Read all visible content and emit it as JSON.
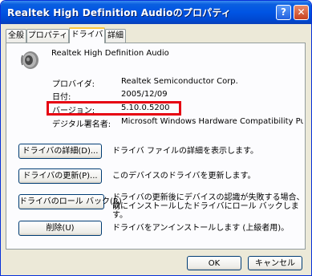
{
  "window": {
    "title": "Realtek High Definition Audioのプロパティ",
    "help_label": "?",
    "close_label": "✕"
  },
  "tabs": [
    {
      "label": "全般"
    },
    {
      "label": "プロパティ"
    },
    {
      "label": "ドライバ",
      "active": true
    },
    {
      "label": "詳細"
    }
  ],
  "device": {
    "name": "Realtek High Definition Audio",
    "icon": "speaker-icon"
  },
  "info": {
    "provider_label": "プロバイダ:",
    "provider_value": "Realtek Semiconductor Corp.",
    "date_label": "日付:",
    "date_value": "2005/12/09",
    "version_label": "バージョン:",
    "version_value": "5.10.0.5200",
    "signer_label": "デジタル署名者:",
    "signer_value": "Microsoft Windows Hardware Compatibility Publishe"
  },
  "actions": {
    "details_label": "ドライバの詳細(D)...",
    "details_desc": "ドライバ ファイルの詳細を表示します。",
    "update_label": "ドライバの更新(P)...",
    "update_desc": "このデバイスのドライバを更新します。",
    "rollback_label": "ドライバのロール バック(R)",
    "rollback_desc_1": "ドライバの更新後にデバイスの認識が失敗する場合、以",
    "rollback_desc_2": "前にインストールしたドライバにロール バックします。",
    "uninstall_label": "削除(U)",
    "uninstall_desc": "ドライバをアンインストールします (上級者用)。"
  },
  "footer": {
    "ok_label": "OK",
    "cancel_label": "キャンセル"
  },
  "colors": {
    "titlebar": "#0054e3",
    "highlight": "#e60012",
    "face": "#ece9d8"
  }
}
